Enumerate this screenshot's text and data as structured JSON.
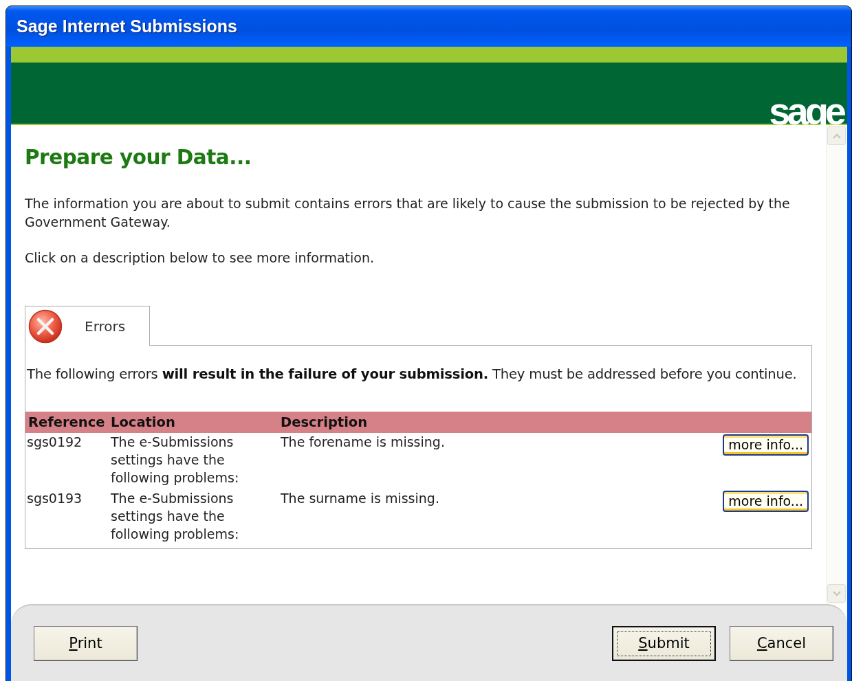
{
  "window": {
    "title": "Sage Internet Submissions"
  },
  "banner": {
    "logo": "sage"
  },
  "heading": "Prepare your Data...",
  "intro": [
    "The information you are about to submit contains errors that are likely to cause the submission to be rejected by the Government Gateway.",
    "Click on a description below to see more information."
  ],
  "tabs": [
    {
      "label": "Errors",
      "kind": "error",
      "selected": true
    }
  ],
  "panel": {
    "message": "The following errors **will result in the failure of your submission.** They must be addressed before you continue."
  },
  "table": {
    "columns": [
      "Reference",
      "Location",
      "Description"
    ],
    "rows": [
      {
        "reference": "sgs0192",
        "location": "The e-Submissions settings have the following problems:",
        "description": "The forename is missing.",
        "button": "more info..."
      },
      {
        "reference": "sgs0193",
        "location": "The e-Submissions settings have the following problems:",
        "description": "The surname is missing.",
        "button": "more info..."
      }
    ]
  },
  "buttons": {
    "left": [
      {
        "mnemonic": "P",
        "rest": "rint",
        "focused": false
      }
    ],
    "right": [
      {
        "mnemonic": "S",
        "rest": "ubmit",
        "focused": true
      },
      {
        "mnemonic": "C",
        "rest": "ancel",
        "focused": false
      }
    ]
  }
}
